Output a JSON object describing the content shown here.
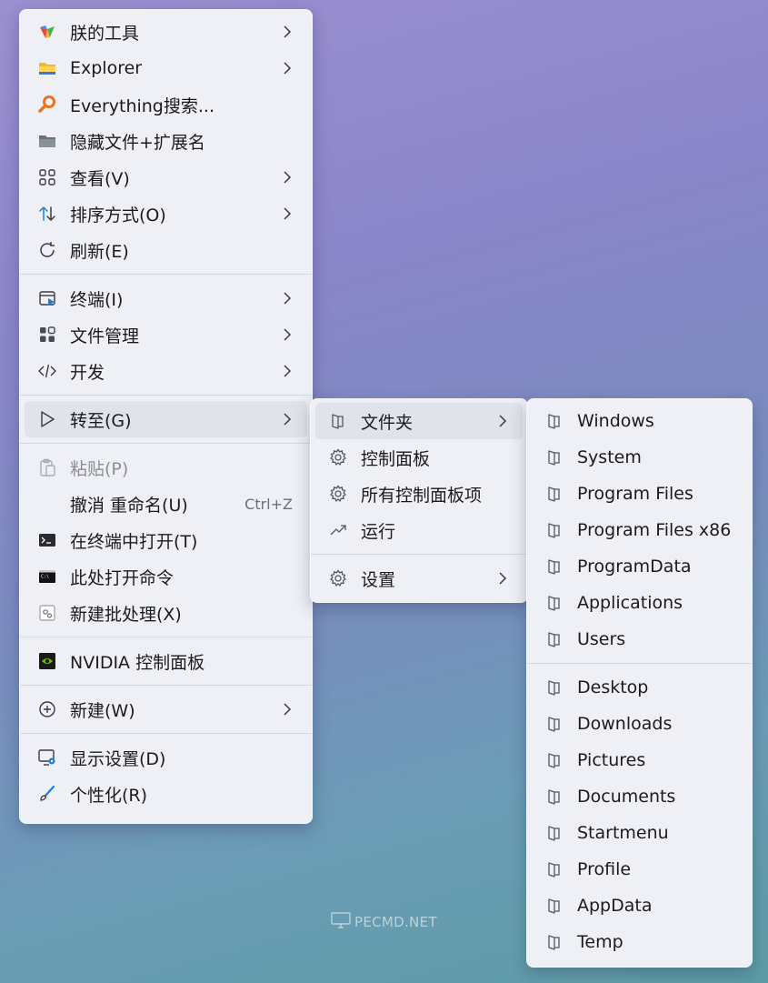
{
  "main_menu": {
    "items": [
      {
        "label": "朕的工具",
        "icon": "rainbow-logo-icon",
        "submenu": true
      },
      {
        "label": "Explorer",
        "icon": "folder-yellow-icon",
        "submenu": true
      },
      {
        "label": "Everything搜索...",
        "icon": "magnifier-orange-icon",
        "submenu": false
      },
      {
        "label": "隐藏文件+扩展名",
        "icon": "folder-gray-icon",
        "submenu": false
      },
      {
        "label": "查看(V)",
        "icon": "grid-icon",
        "submenu": true
      },
      {
        "label": "排序方式(O)",
        "icon": "sort-arrows-icon",
        "submenu": true
      },
      {
        "label": "刷新(E)",
        "icon": "refresh-icon",
        "submenu": false
      },
      {
        "label": "终端(I)",
        "icon": "terminal-window-icon",
        "submenu": true
      },
      {
        "label": "文件管理",
        "icon": "apps-grid-icon",
        "submenu": true
      },
      {
        "label": "开发",
        "icon": "code-icon",
        "submenu": true
      },
      {
        "label": "转至(G)",
        "icon": "cursor-arrow-icon",
        "submenu": true
      },
      {
        "label": "粘贴(P)",
        "icon": "clipboard-icon",
        "submenu": false
      },
      {
        "label": "撤消 重命名(U)",
        "shortcut": "Ctrl+Z",
        "submenu": false
      },
      {
        "label": "在终端中打开(T)",
        "icon": "console-icon",
        "submenu": false
      },
      {
        "label": "此处打开命令",
        "icon": "cmd-icon",
        "submenu": false
      },
      {
        "label": "新建批处理(X)",
        "icon": "batch-file-icon",
        "submenu": false
      },
      {
        "label": "NVIDIA 控制面板",
        "icon": "nvidia-icon",
        "submenu": false
      },
      {
        "label": "新建(W)",
        "icon": "plus-circle-icon",
        "submenu": true
      },
      {
        "label": "显示设置(D)",
        "icon": "display-settings-icon",
        "submenu": false
      },
      {
        "label": "个性化(R)",
        "icon": "brush-icon",
        "submenu": false
      }
    ]
  },
  "goto_menu": {
    "items": [
      {
        "label": "文件夹",
        "icon": "folder-outline-icon",
        "submenu": true
      },
      {
        "label": "控制面板",
        "icon": "gear-icon",
        "submenu": false
      },
      {
        "label": "所有控制面板项",
        "icon": "gear-icon",
        "submenu": false
      },
      {
        "label": "运行",
        "icon": "trend-arrow-icon",
        "submenu": false
      },
      {
        "label": "设置",
        "icon": "gear-icon",
        "submenu": true
      }
    ]
  },
  "folder_menu": {
    "items": [
      {
        "label": "Windows"
      },
      {
        "label": "System"
      },
      {
        "label": "Program Files"
      },
      {
        "label": "Program Files x86"
      },
      {
        "label": "ProgramData"
      },
      {
        "label": "Applications"
      },
      {
        "label": "Users"
      },
      {
        "label": "Desktop"
      },
      {
        "label": "Downloads"
      },
      {
        "label": "Pictures"
      },
      {
        "label": "Documents"
      },
      {
        "label": "Startmenu"
      },
      {
        "label": "Profile"
      },
      {
        "label": "AppData"
      },
      {
        "label": "Temp"
      }
    ]
  },
  "watermark": {
    "text": "PECMD.NET"
  }
}
